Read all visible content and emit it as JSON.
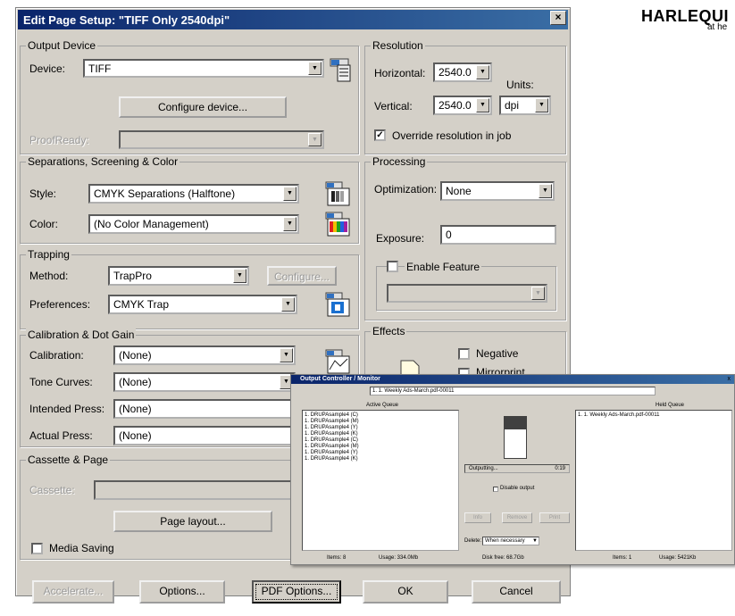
{
  "brand": {
    "logo": "HARLEQUI",
    "tagline": "at he"
  },
  "dialog": {
    "title": "Edit Page Setup: \"TIFF Only 2540dpi\"",
    "close": "×",
    "output_device": {
      "legend": "Output Device",
      "device_label": "Device:",
      "device_value": "TIFF",
      "configure_button": "Configure device...",
      "proofready_label": "ProofReady:",
      "proofready_value": ""
    },
    "resolution": {
      "legend": "Resolution",
      "horizontal_label": "Horizontal:",
      "horizontal_value": "2540.0",
      "vertical_label": "Vertical:",
      "vertical_value": "2540.0",
      "units_label": "Units:",
      "units_value": "dpi",
      "override_label": "Override resolution in job",
      "override_checked": true
    },
    "separations": {
      "legend": "Separations, Screening & Color",
      "style_label": "Style:",
      "style_value": "CMYK Separations (Halftone)",
      "color_label": "Color:",
      "color_value": "(No Color Management)"
    },
    "processing": {
      "legend": "Processing",
      "optimization_label": "Optimization:",
      "optimization_value": "None",
      "exposure_label": "Exposure:",
      "exposure_value": "0",
      "enable_feature_label": "Enable Feature",
      "feature_value": ""
    },
    "trapping": {
      "legend": "Trapping",
      "method_label": "Method:",
      "method_value": "TrapPro",
      "configure_button": "Configure...",
      "preferences_label": "Preferences:",
      "preferences_value": "CMYK Trap"
    },
    "calibration": {
      "legend": "Calibration & Dot Gain",
      "calibration_label": "Calibration:",
      "calibration_value": "(None)",
      "tone_curves_label": "Tone Curves:",
      "tone_curves_value": "(None)",
      "intended_press_label": "Intended Press:",
      "intended_press_value": "(None)",
      "actual_press_label": "Actual Press:",
      "actual_press_value": "(None)"
    },
    "effects": {
      "legend": "Effects",
      "negative_label": "Negative",
      "mirrorprint_label": "Mirrorprint"
    },
    "cassette": {
      "legend": "Cassette & Page",
      "cassette_label": "Cassette:",
      "page_layout_button": "Page layout...",
      "media_saving_label": "Media Saving"
    },
    "buttons": {
      "accelerate": "Accelerate...",
      "options": "Options...",
      "pdf_options": "PDF Options...",
      "ok": "OK",
      "cancel": "Cancel"
    }
  },
  "monitor": {
    "title": "Output Controller / Monitor",
    "close": "x",
    "current_job": "1. 1. Weekly Ads-March.pdf-00011",
    "active_queue_label": "Active Queue",
    "held_queue_label": "Held Queue",
    "active_items": [
      "1. DRUPAsample4 (C)",
      "1. DRUPAsample4 (M)",
      "1. DRUPAsample4 (Y)",
      "1. DRUPAsample4 (K)",
      "1. DRUPAsample4 (C)",
      "1. DRUPAsample4 (M)",
      "1. DRUPAsample4 (Y)",
      "1. DRUPAsample4 (K)"
    ],
    "held_items": [
      "1. 1. Weekly Ads-March.pdf-00011"
    ],
    "status_text": "Outputting...",
    "status_time": "0:19",
    "disable_output_label": "Disable output",
    "info_button": "Info",
    "remove_button": "Remove",
    "print_button": "Print",
    "delete_label": "Delete:",
    "delete_value": "When necessary",
    "active_items_count": "Items: 8",
    "active_usage": "Usage: 334.0Mb",
    "disk_free": "Disk free: 68.7Gb",
    "held_items_count": "Items: 1",
    "held_usage": "Usage: 5421Kb"
  }
}
